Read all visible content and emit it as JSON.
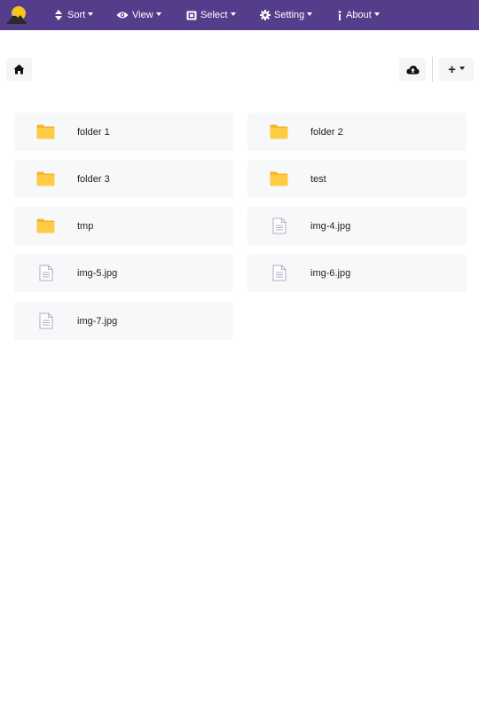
{
  "navbar": {
    "logo_icon": "mountain-sun-logo-icon",
    "menu": [
      {
        "label": "Sort",
        "icon": "sort-icon"
      },
      {
        "label": "View",
        "icon": "eye-icon"
      },
      {
        "label": "Select",
        "icon": "select-icon"
      },
      {
        "label": "Setting",
        "icon": "gear-icon"
      },
      {
        "label": "About",
        "icon": "info-icon"
      }
    ],
    "colors": {
      "background": "#563d8b",
      "text": "#ffffff"
    }
  },
  "toolbar": {
    "home_icon": "home-icon",
    "upload_icon": "cloud-upload-icon",
    "add_label": "+"
  },
  "items": [
    {
      "name": "folder 1",
      "type": "folder"
    },
    {
      "name": "folder 2",
      "type": "folder"
    },
    {
      "name": "folder 3",
      "type": "folder"
    },
    {
      "name": "test",
      "type": "folder"
    },
    {
      "name": "tmp",
      "type": "folder"
    },
    {
      "name": "img-4.jpg",
      "type": "file"
    },
    {
      "name": "img-5.jpg",
      "type": "file"
    },
    {
      "name": "img-6.jpg",
      "type": "file"
    },
    {
      "name": "img-7.jpg",
      "type": "file"
    }
  ],
  "colors": {
    "folder": "#ffc83d",
    "file_outline": "#b7a9c9",
    "item_bg": "#f7f8fa"
  }
}
